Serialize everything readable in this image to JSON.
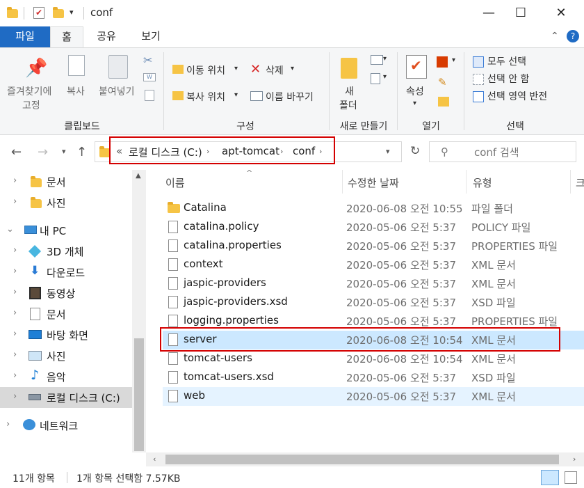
{
  "window": {
    "title": "conf",
    "controls": {
      "minimize": "—",
      "maximize": "☐",
      "close": "✕"
    }
  },
  "ribbon_tabs": {
    "file": "파일",
    "home": "홈",
    "share": "공유",
    "view": "보기"
  },
  "ribbon": {
    "clipboard": {
      "label": "클립보드",
      "pin_line1": "즐겨찾기에",
      "pin_line2": "고정",
      "copy": "복사",
      "paste": "붙여넣기"
    },
    "organize": {
      "label": "구성",
      "move_to": "이동 위치",
      "delete": "삭제",
      "copy_to": "복사 위치",
      "rename": "이름 바꾸기"
    },
    "new": {
      "label": "새로 만들기",
      "new_folder_line1": "새",
      "new_folder_line2": "폴더"
    },
    "open": {
      "label": "열기",
      "properties": "속성"
    },
    "select": {
      "label": "선택",
      "select_all": "모두 선택",
      "select_none": "선택 안 함",
      "invert": "선택 영역 반전"
    }
  },
  "address": {
    "prefix": "«",
    "crumbs": [
      "로컬 디스크 (C:)",
      "apt-tomcat",
      "conf"
    ],
    "search_placeholder": "conf 검색"
  },
  "nav": {
    "items": [
      {
        "label": "문서",
        "icon": "folder-icon"
      },
      {
        "label": "사진",
        "icon": "folder-icon"
      },
      {
        "label": "내 PC",
        "icon": "pc-icon"
      },
      {
        "label": "3D 개체",
        "icon": "cube-icon"
      },
      {
        "label": "다운로드",
        "icon": "download-icon"
      },
      {
        "label": "동영상",
        "icon": "video-icon"
      },
      {
        "label": "문서",
        "icon": "document-icon"
      },
      {
        "label": "바탕 화면",
        "icon": "desktop-icon"
      },
      {
        "label": "사진",
        "icon": "picture-icon"
      },
      {
        "label": "음악",
        "icon": "music-icon"
      },
      {
        "label": "로컬 디스크 (C:)",
        "icon": "drive-icon"
      },
      {
        "label": "네트워크",
        "icon": "network-icon"
      }
    ]
  },
  "columns": {
    "name": "이름",
    "date": "수정한 날짜",
    "type": "유형",
    "more": "크"
  },
  "files": [
    {
      "name": "Catalina",
      "date": "2020-06-08 오전 10:55",
      "type": "파일 폴더",
      "kind": "folder"
    },
    {
      "name": "catalina.policy",
      "date": "2020-05-06 오전 5:37",
      "type": "POLICY 파일",
      "kind": "file"
    },
    {
      "name": "catalina.properties",
      "date": "2020-05-06 오전 5:37",
      "type": "PROPERTIES 파일",
      "kind": "file"
    },
    {
      "name": "context",
      "date": "2020-05-06 오전 5:37",
      "type": "XML 문서",
      "kind": "file"
    },
    {
      "name": "jaspic-providers",
      "date": "2020-05-06 오전 5:37",
      "type": "XML 문서",
      "kind": "file"
    },
    {
      "name": "jaspic-providers.xsd",
      "date": "2020-05-06 오전 5:37",
      "type": "XSD 파일",
      "kind": "file"
    },
    {
      "name": "logging.properties",
      "date": "2020-05-06 오전 5:37",
      "type": "PROPERTIES 파일",
      "kind": "file"
    },
    {
      "name": "server",
      "date": "2020-06-08 오전 10:54",
      "type": "XML 문서",
      "kind": "file"
    },
    {
      "name": "tomcat-users",
      "date": "2020-06-08 오전 10:54",
      "type": "XML 문서",
      "kind": "file"
    },
    {
      "name": "tomcat-users.xsd",
      "date": "2020-05-06 오전 5:37",
      "type": "XSD 파일",
      "kind": "file"
    },
    {
      "name": "web",
      "date": "2020-05-06 오전 5:37",
      "type": "XML 문서",
      "kind": "file"
    }
  ],
  "status": {
    "count": "11개 항목",
    "selection": "1개 항목 선택함 7.57KB"
  },
  "colors": {
    "accent": "#1f6bc4",
    "selected_row": "#cce8ff",
    "highlight_box": "#d40000"
  }
}
